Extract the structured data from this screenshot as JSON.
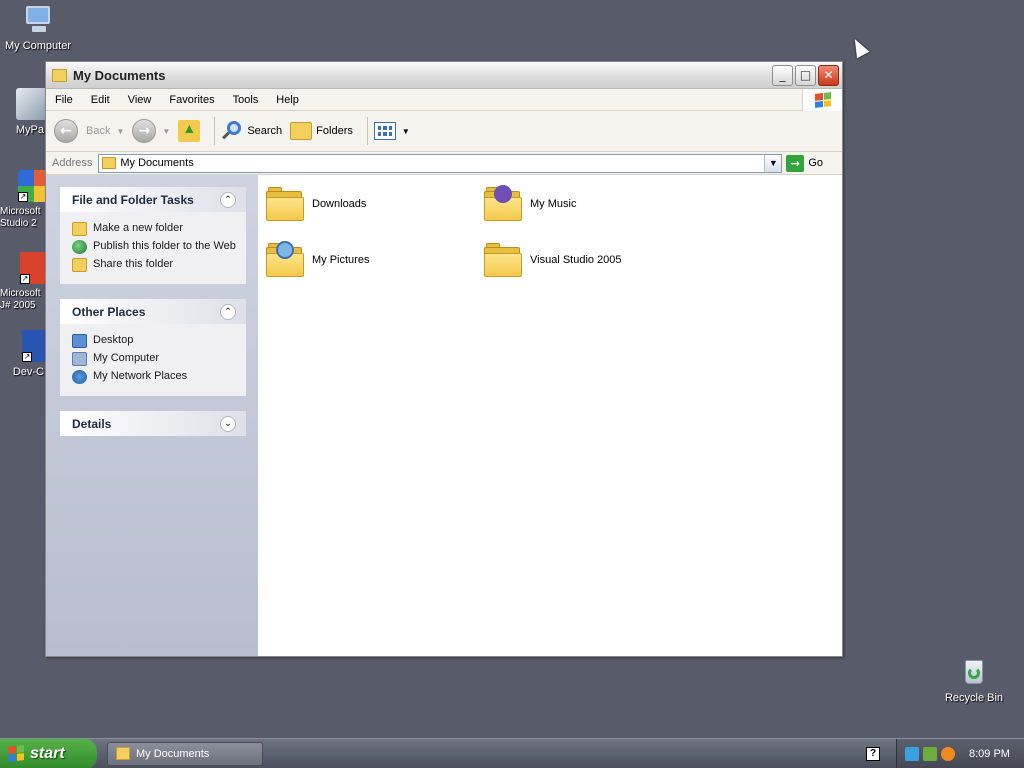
{
  "desktop": {
    "icons": [
      {
        "label": "My Computer"
      },
      {
        "label": "MyPa"
      },
      {
        "label": "Microsoft Studio 2"
      },
      {
        "label": "Microsoft J# 2005"
      },
      {
        "label": "Dev-C"
      },
      {
        "label": "Recycle Bin"
      }
    ]
  },
  "window": {
    "title": "My Documents",
    "controls": {
      "minimize": "_",
      "maximize": "□",
      "close": "✕"
    }
  },
  "menubar": {
    "items": [
      "File",
      "Edit",
      "View",
      "Favorites",
      "Tools",
      "Help"
    ]
  },
  "toolbar": {
    "back_label": "Back",
    "search_label": "Search",
    "folders_label": "Folders"
  },
  "address": {
    "label": "Address",
    "value": "My Documents",
    "go_label": "Go"
  },
  "taskpane": {
    "sections": [
      {
        "title": "File and Folder Tasks",
        "items": [
          "Make a new folder",
          "Publish this folder to the Web",
          "Share this folder"
        ]
      },
      {
        "title": "Other Places",
        "items": [
          "Desktop",
          "My Computer",
          "My Network Places"
        ]
      },
      {
        "title": "Details",
        "items": []
      }
    ]
  },
  "files": [
    {
      "name": "Downloads",
      "icon": "folder-icon"
    },
    {
      "name": "My Music",
      "icon": "music-folder-icon"
    },
    {
      "name": "My Pictures",
      "icon": "pictures-folder-icon"
    },
    {
      "name": "Visual Studio 2005",
      "icon": "folder-icon"
    }
  ],
  "taskbar": {
    "start_label": "start",
    "task_button_label": "My Documents",
    "help_glyph": "?",
    "clock": "8:09 PM"
  }
}
